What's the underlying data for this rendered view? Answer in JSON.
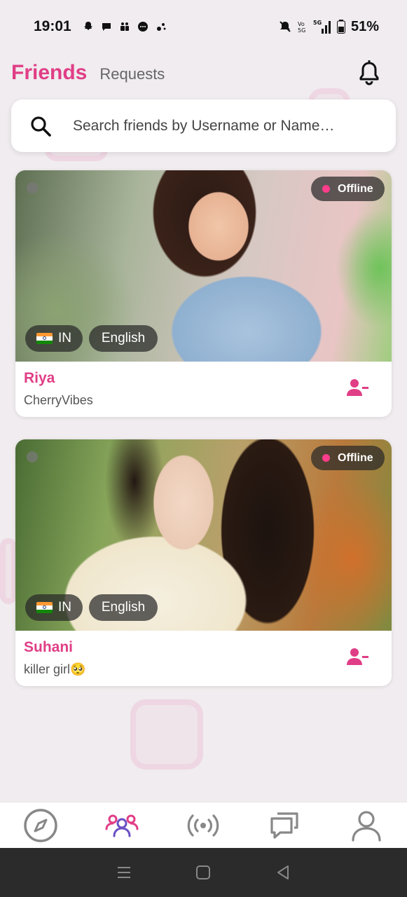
{
  "status_bar": {
    "time": "19:01",
    "battery": "51%",
    "network_label": "5G"
  },
  "header": {
    "tabs": [
      {
        "label": "Friends",
        "active": true
      },
      {
        "label": "Requests",
        "active": false
      }
    ],
    "notification_icon": "bell-icon"
  },
  "search": {
    "placeholder": "Search friends by Username or Name…",
    "value": ""
  },
  "friends": [
    {
      "name": "Riya",
      "username": "CherryVibes",
      "status": "Offline",
      "country": "IN",
      "language": "English"
    },
    {
      "name": "Suhani",
      "username": "killer girl🥺",
      "status": "Offline",
      "country": "IN",
      "language": "English"
    }
  ],
  "bottom_nav": [
    {
      "name": "explore",
      "icon": "compass-icon",
      "active": false
    },
    {
      "name": "friends",
      "icon": "friends-icon",
      "active": true
    },
    {
      "name": "live",
      "icon": "broadcast-icon",
      "active": false
    },
    {
      "name": "chats",
      "icon": "chat-icon",
      "active": false
    },
    {
      "name": "profile",
      "icon": "profile-icon",
      "active": false
    }
  ],
  "colors": {
    "accent": "#e03e86",
    "background": "#f0ecef",
    "nav_active": "#6a4fc4"
  }
}
